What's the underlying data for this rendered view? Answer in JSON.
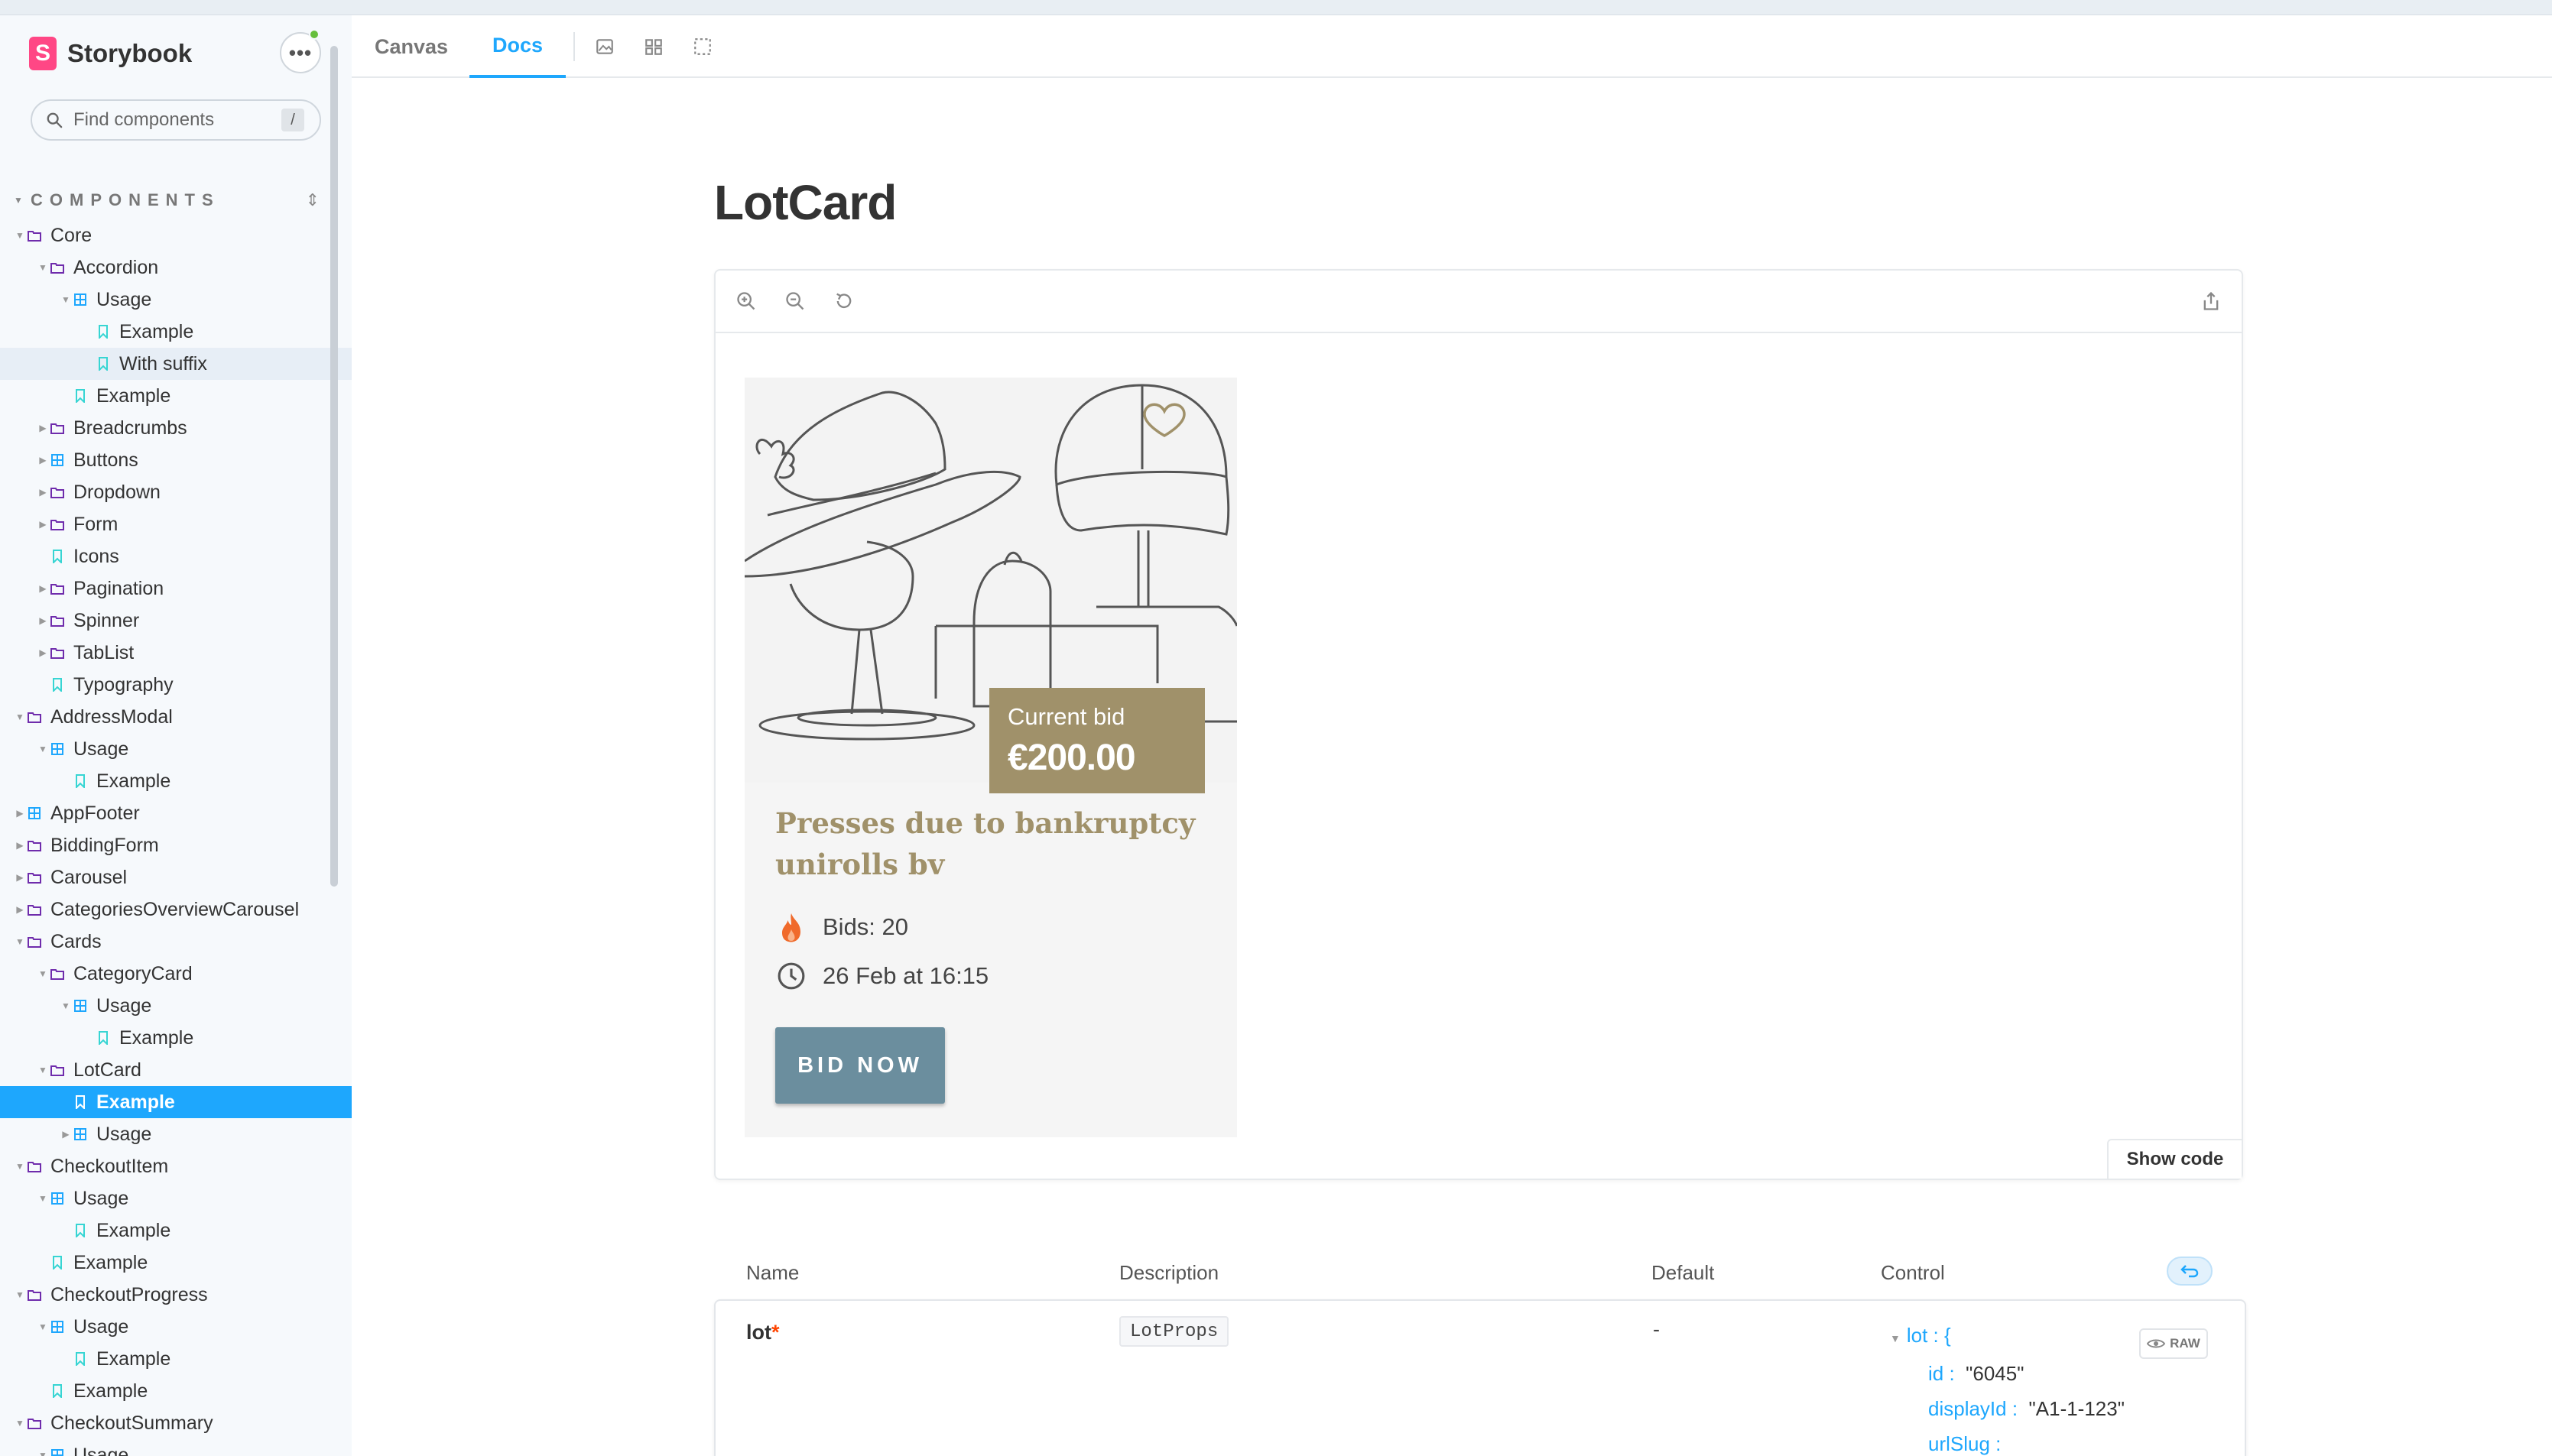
{
  "sidebar": {
    "brand": "Storybook",
    "menu_label": "•••",
    "search": {
      "placeholder": "Find components",
      "shortcut": "/"
    },
    "section_title": "COMPONENTS",
    "items": [
      {
        "label": "Core",
        "level": 0,
        "type": "folder",
        "expanded": true
      },
      {
        "label": "Accordion",
        "level": 1,
        "type": "folder",
        "expanded": true
      },
      {
        "label": "Usage",
        "level": 2,
        "type": "component",
        "expanded": true
      },
      {
        "label": "Example",
        "level": 3,
        "type": "story"
      },
      {
        "label": "With suffix",
        "level": 3,
        "type": "story",
        "hover": true
      },
      {
        "label": "Example",
        "level": 2,
        "type": "story"
      },
      {
        "label": "Breadcrumbs",
        "level": 1,
        "type": "folder",
        "expanded": false
      },
      {
        "label": "Buttons",
        "level": 1,
        "type": "component",
        "expanded": false
      },
      {
        "label": "Dropdown",
        "level": 1,
        "type": "folder",
        "expanded": false
      },
      {
        "label": "Form",
        "level": 1,
        "type": "folder",
        "expanded": false
      },
      {
        "label": "Icons",
        "level": 1,
        "type": "story"
      },
      {
        "label": "Pagination",
        "level": 1,
        "type": "folder",
        "expanded": false
      },
      {
        "label": "Spinner",
        "level": 1,
        "type": "folder",
        "expanded": false
      },
      {
        "label": "TabList",
        "level": 1,
        "type": "folder",
        "expanded": false
      },
      {
        "label": "Typography",
        "level": 1,
        "type": "story"
      },
      {
        "label": "AddressModal",
        "level": 0,
        "type": "folder",
        "expanded": true
      },
      {
        "label": "Usage",
        "level": 1,
        "type": "component",
        "expanded": true
      },
      {
        "label": "Example",
        "level": 2,
        "type": "story"
      },
      {
        "label": "AppFooter",
        "level": 0,
        "type": "component",
        "expanded": false
      },
      {
        "label": "BiddingForm",
        "level": 0,
        "type": "folder",
        "expanded": false
      },
      {
        "label": "Carousel",
        "level": 0,
        "type": "folder",
        "expanded": false
      },
      {
        "label": "CategoriesOverviewCarousel",
        "level": 0,
        "type": "folder",
        "expanded": false
      },
      {
        "label": "Cards",
        "level": 0,
        "type": "folder",
        "expanded": true
      },
      {
        "label": "CategoryCard",
        "level": 1,
        "type": "folder",
        "expanded": true
      },
      {
        "label": "Usage",
        "level": 2,
        "type": "component",
        "expanded": true
      },
      {
        "label": "Example",
        "level": 3,
        "type": "story"
      },
      {
        "label": "LotCard",
        "level": 1,
        "type": "folder",
        "expanded": true
      },
      {
        "label": "Example",
        "level": 2,
        "type": "story",
        "selected": true
      },
      {
        "label": "Usage",
        "level": 2,
        "type": "component",
        "expanded": false
      },
      {
        "label": "CheckoutItem",
        "level": 0,
        "type": "folder",
        "expanded": true
      },
      {
        "label": "Usage",
        "level": 1,
        "type": "component",
        "expanded": true
      },
      {
        "label": "Example",
        "level": 2,
        "type": "story"
      },
      {
        "label": "Example",
        "level": 1,
        "type": "story"
      },
      {
        "label": "CheckoutProgress",
        "level": 0,
        "type": "folder",
        "expanded": true
      },
      {
        "label": "Usage",
        "level": 1,
        "type": "component",
        "expanded": true
      },
      {
        "label": "Example",
        "level": 2,
        "type": "story"
      },
      {
        "label": "Example",
        "level": 1,
        "type": "story"
      },
      {
        "label": "CheckoutSummary",
        "level": 0,
        "type": "folder",
        "expanded": true
      },
      {
        "label": "Usage",
        "level": 1,
        "type": "component",
        "expanded": true
      }
    ]
  },
  "toolbar": {
    "tabs": [
      {
        "label": "Canvas",
        "active": false
      },
      {
        "label": "Docs",
        "active": true
      }
    ],
    "icons": [
      "image-icon",
      "grid-icon",
      "outline-icon"
    ]
  },
  "main": {
    "title": "LotCard",
    "preview": {
      "icons": [
        "zoom-in-icon",
        "zoom-out-icon",
        "zoom-reset-icon",
        "share-icon"
      ],
      "show_code": "Show code"
    }
  },
  "lot_card": {
    "bid_label": "Current bid",
    "bid_amount": "€200.00",
    "title": "Presses due to bankruptcy unirolls bv",
    "bids": "Bids: 20",
    "closing": "26 Feb at 16:15",
    "button": "BID NOW",
    "colors": {
      "accent": "#a0916a",
      "button": "#6b8e9e",
      "flame": "#f06a2b"
    }
  },
  "args_table": {
    "headers": {
      "name": "Name",
      "description": "Description",
      "default": "Default",
      "control": "Control"
    },
    "rows": [
      {
        "name": "lot",
        "required": "*",
        "type": "LotProps",
        "default": "-",
        "control": {
          "root": "lot : {",
          "fields": [
            {
              "key": "id :",
              "value": "\"6045\""
            },
            {
              "key": "displayId :",
              "value": "\"A1-1-123\""
            },
            {
              "key": "urlSlug :",
              "value": ""
            }
          ],
          "raw_label": "RAW"
        }
      }
    ]
  },
  "theme": {
    "secondary": "#1ea7fd",
    "brand": "#ff4785",
    "sidebar_bg": "#f6f9fc"
  }
}
